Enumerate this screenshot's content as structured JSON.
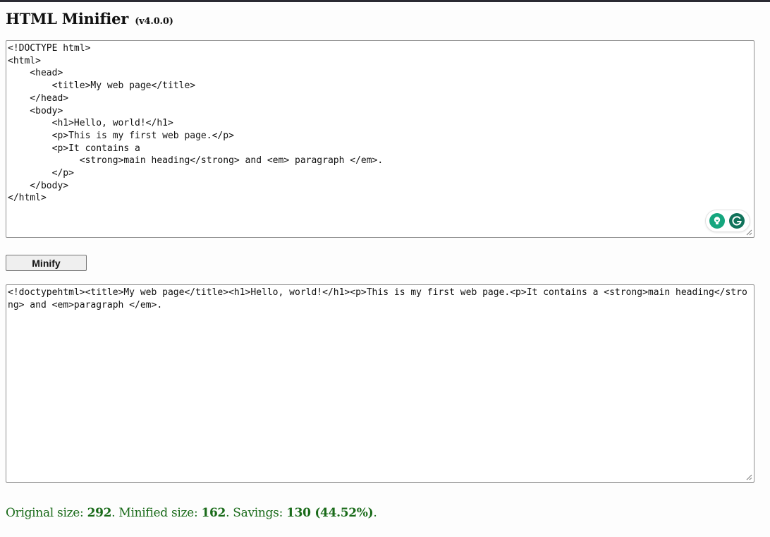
{
  "header": {
    "title": "HTML Minifier",
    "version": "(v4.0.0)"
  },
  "input": {
    "value": "<!DOCTYPE html>\n<html>\n    <head>\n        <title>My web page</title>\n    </head>\n    <body>\n        <h1>Hello, world!</h1>\n        <p>This is my first web page.</p>\n        <p>It contains a\n             <strong>main heading</strong> and <em> paragraph </em>.\n        </p>\n    </body>\n</html>"
  },
  "grammarly": {
    "icons": [
      "lightbulb-icon",
      "grammarly-g-icon"
    ],
    "colors": {
      "bulb": "#15a67e",
      "brand": "#11735b"
    }
  },
  "actions": {
    "minify_label": "Minify"
  },
  "output": {
    "value": "<!doctypehtml><title>My web page</title><h1>Hello, world!</h1><p>This is my first web page.<p>It contains a <strong>main heading</strong> and <em>paragraph </em>."
  },
  "stats": {
    "original_label": "Original size: ",
    "original_size": "292",
    "minified_label": ". Minified size: ",
    "minified_size": "162",
    "savings_label": ". Savings: ",
    "savings": "130 (44.52%)",
    "end": ".",
    "color": "#1a6b1a"
  }
}
